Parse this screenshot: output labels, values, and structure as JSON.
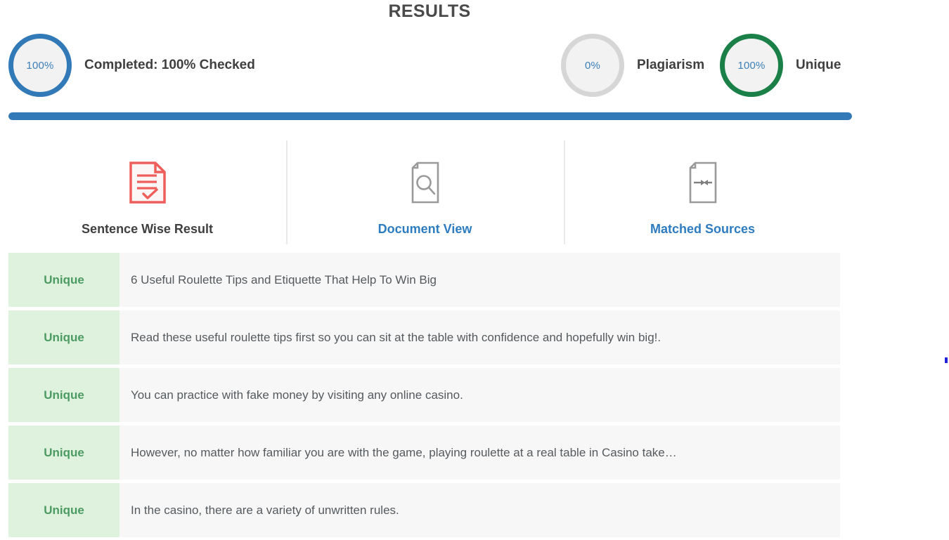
{
  "header": {
    "title": "RESULTS"
  },
  "summary": {
    "completed": {
      "percent": "100%",
      "label": "Completed: 100% Checked",
      "ring_color": "#3279b7",
      "icon": "donut-progress-icon"
    },
    "plagiarism": {
      "percent": "0%",
      "label": "Plagiarism",
      "ring_color": "#d6d6d6",
      "icon": "donut-progress-icon"
    },
    "unique": {
      "percent": "100%",
      "label": "Unique",
      "ring_color": "#1a8048",
      "icon": "donut-progress-icon"
    }
  },
  "progress": {
    "value": 100,
    "value_label": "100%",
    "fill_color": "#3279b7"
  },
  "tabs": [
    {
      "label": "Sentence Wise Result",
      "icon": "document-check-icon",
      "icon_color": "#ee5f5b",
      "active": true
    },
    {
      "label": "Document View",
      "icon": "document-search-icon",
      "icon_color": "#9a9a9a",
      "active": false
    },
    {
      "label": "Matched Sources",
      "icon": "document-arrows-icon",
      "icon_color": "#9a9a9a",
      "active": false
    }
  ],
  "sentences": [
    {
      "status": "Unique",
      "text": "6 Useful Roulette Tips and Etiquette That Help To Win Big"
    },
    {
      "status": "Unique",
      "text": "Read these useful roulette tips first so you can sit at the table with confidence and hopefully win big!."
    },
    {
      "status": "Unique",
      "text": "You can practice with fake money by visiting any online casino."
    },
    {
      "status": "Unique",
      "text": "However, no matter how familiar you are with the game, playing roulette at a real table in Casino take…"
    },
    {
      "status": "Unique",
      "text": "In the casino, there are a variety of unwritten rules."
    }
  ],
  "colors": {
    "accent_blue": "#3279b7",
    "accent_green": "#1a8048",
    "badge_bg": "#dff2dd",
    "badge_text": "#4b9b63",
    "row_bg": "#f7f7f7",
    "link_blue": "#2e7cc0"
  }
}
